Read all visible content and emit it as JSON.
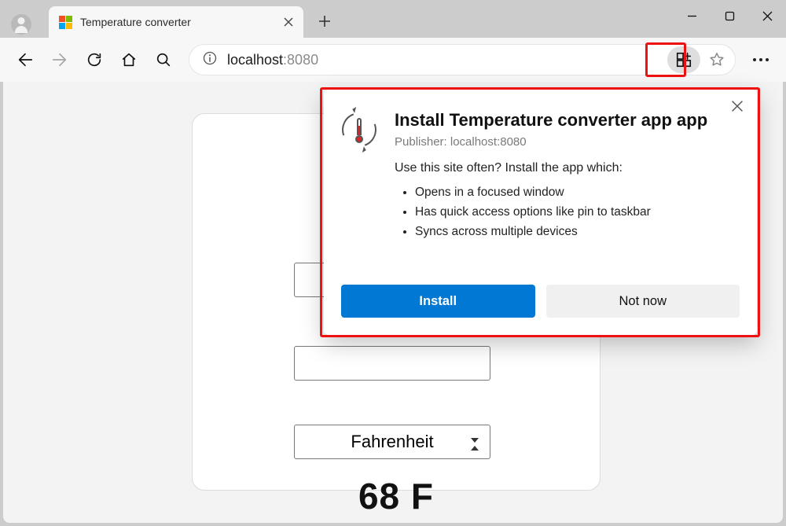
{
  "tab": {
    "title": "Temperature converter"
  },
  "address": {
    "host": "localhost",
    "port": ":8080"
  },
  "page": {
    "select_value": "Fahrenheit",
    "result": "68 F"
  },
  "popup": {
    "title": "Install Temperature converter app app",
    "publisher": "Publisher: localhost:8080",
    "lead": "Use this site often? Install the app which:",
    "bullets": [
      "Opens in a focused window",
      "Has quick access options like pin to taskbar",
      "Syncs across multiple devices"
    ],
    "install": "Install",
    "notnow": "Not now"
  }
}
